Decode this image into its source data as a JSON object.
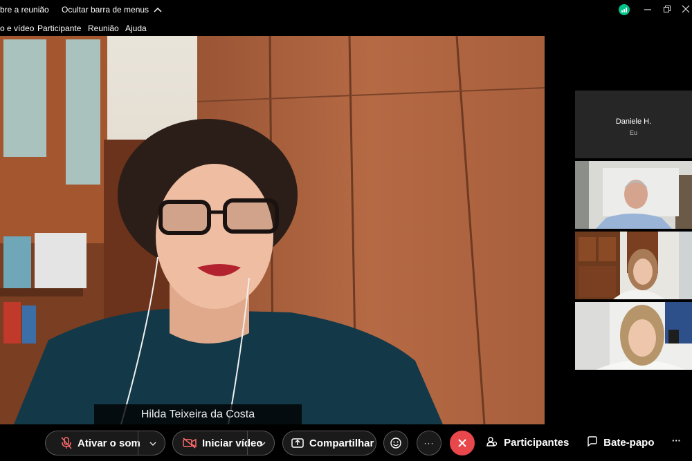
{
  "topbar": {
    "meeting_info": "bre a reunião",
    "hide_menu": "Ocultar barra de menus",
    "hide_menu_chevron": "^"
  },
  "menubar": {
    "items": [
      "o e vídeo",
      "Participante",
      "Reunião",
      "Ajuda"
    ]
  },
  "main_speaker": {
    "name": "Hilda Teixeira da Costa"
  },
  "side_participants": [
    {
      "name": "Daniele H.",
      "subtitle": "Eu"
    }
  ],
  "controls": {
    "unmute": "Ativar o som",
    "start_video": "Iniciar vídeo",
    "share": "Compartilhar",
    "participants": "Participantes",
    "chat": "Bate-papo",
    "more": "···"
  },
  "colors": {
    "end_button": "#e8474c",
    "status_badge": "#00c389"
  }
}
